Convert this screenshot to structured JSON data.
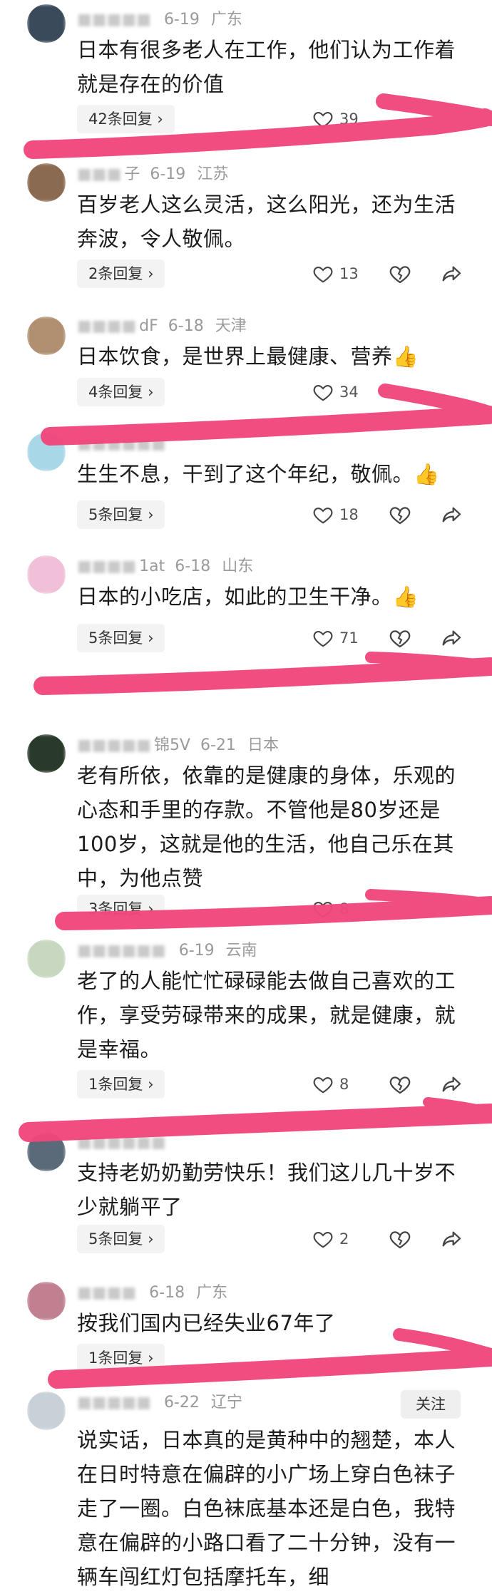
{
  "comments": [
    {
      "user_suffix": "",
      "date": "6-19",
      "location": "广东",
      "text": "日本有很多老人在工作，他们认为工作着就是存在的价值",
      "reply_label": "42条回复",
      "likes": "39",
      "avatar_color": "#3a4a5a"
    },
    {
      "user_suffix": "子",
      "date": "6-19",
      "location": "江苏",
      "text": "百岁老人这么灵活，这么阳光，还为生活奔波，令人敬佩。",
      "reply_label": "2条回复",
      "likes": "13",
      "avatar_color": "#8a6a50"
    },
    {
      "user_suffix": "dF",
      "date": "6-18",
      "location": "天津",
      "text": "日本饮食，是世界上最健康、营养👍",
      "reply_label": "4条回复",
      "likes": "34",
      "avatar_color": "#b09070"
    },
    {
      "user_suffix": "",
      "date": "",
      "location": "",
      "text": "生生不息，干到了这个年纪，敬佩。👍",
      "reply_label": "5条回复",
      "likes": "18",
      "avatar_color": "#a8d8e8"
    },
    {
      "user_suffix": "1at",
      "date": "6-18",
      "location": "山东",
      "text": "日本的小吃店，如此的卫生干净。👍",
      "reply_label": "5条回复",
      "likes": "71",
      "avatar_color": "#f0c0d8"
    },
    {
      "user_suffix": "锦5V",
      "date": "6-21",
      "location": "日本",
      "text": "老有所依，依靠的是健康的身体，乐观的心态和手里的存款。不管他是80岁还是100岁，这就是他的生活，他自己乐在其中，为他点赞",
      "reply_label": "3条回复",
      "likes": "8",
      "avatar_color": "#2a3a2a"
    },
    {
      "user_suffix": "",
      "date": "6-19",
      "location": "云南",
      "text": "老了的人能忙忙碌碌能去做自己喜欢的工作，享受劳碌带来的成果，就是健康，就是幸福。",
      "reply_label": "1条回复",
      "likes": "8",
      "avatar_color": "#c8d8c0"
    },
    {
      "user_suffix": "",
      "date": "",
      "location": "",
      "text": "支持老奶奶勤劳快乐！我们这儿几十岁不少就躺平了",
      "reply_label": "5条回复",
      "likes": "2",
      "avatar_color": "#5a6a78"
    },
    {
      "user_suffix": "",
      "date": "6-18",
      "location": "广东",
      "text": "按我们国内已经失业67年了",
      "reply_label": "1条回复",
      "likes": "",
      "avatar_color": "#c08090"
    },
    {
      "user_suffix": "",
      "date": "6-22",
      "location": "辽宁",
      "text": "说实话，日本真的是黄种中的翘楚，本人在日时特意在偏辟的小广场上穿白色袜子走了一圈。白色袜底基本还是白色，我特意在偏辟的小路口看了二十分钟，没有一辆车闯红灯包括摩托车，细",
      "reply_label": "",
      "likes": "",
      "avatar_color": "#c8d0d8",
      "follow_label": "关注"
    }
  ],
  "colors": {
    "highlight": "#f0467c",
    "meta": "#9a9a9a",
    "text": "#1c1c1c"
  },
  "icons": {
    "like": "heart-outline-icon",
    "dislike": "broken-heart-icon",
    "share": "share-arrow-icon",
    "reply": "chevron-right-icon"
  }
}
